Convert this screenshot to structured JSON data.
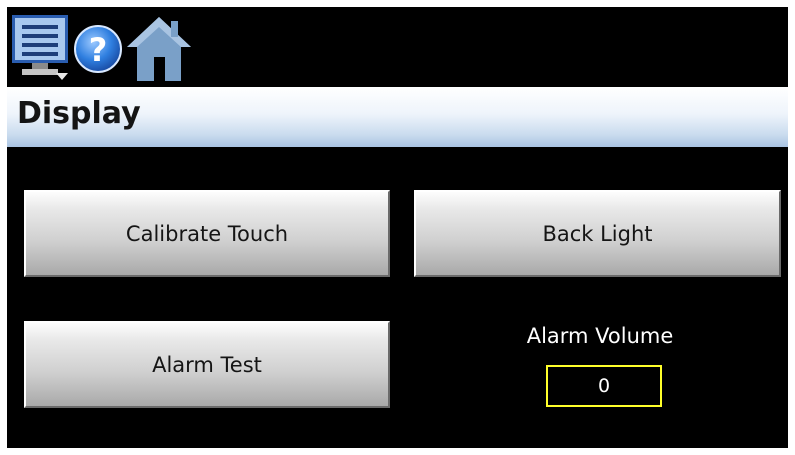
{
  "toolbar": {
    "icons": [
      "monitor-menu-icon",
      "help-icon",
      "home-icon"
    ]
  },
  "page": {
    "title": "Display"
  },
  "buttons": {
    "calibrate_touch": "Calibrate Touch",
    "back_light": "Back Light",
    "alarm_test": "Alarm Test"
  },
  "alarm_volume": {
    "label": "Alarm Volume",
    "value": "0"
  },
  "colors": {
    "screen_background": "#000000",
    "title_bar_gradient": [
      "#ffffff",
      "#a9c3e2"
    ],
    "button_gradient": [
      "#fdfdfd",
      "#a9a9a9"
    ],
    "volume_field_border": "#ffff2a",
    "volume_text": "#ffffff"
  }
}
